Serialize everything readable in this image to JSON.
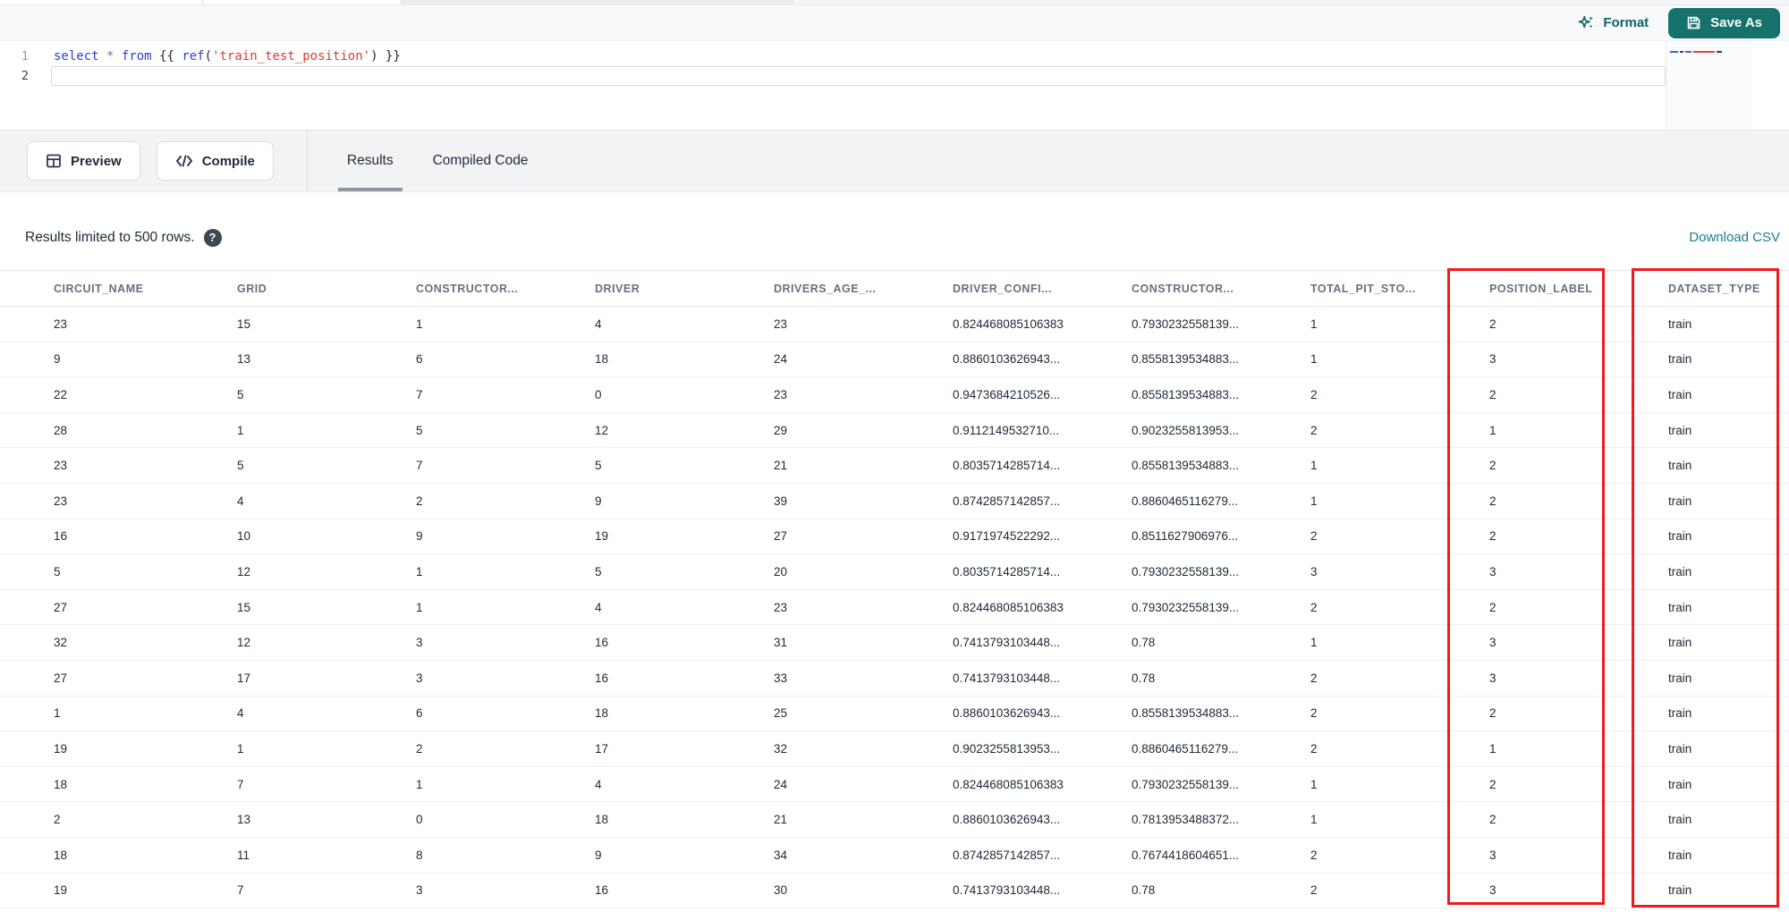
{
  "header": {
    "format_label": "Format",
    "save_as_label": "Save As"
  },
  "editor": {
    "lines": [
      {
        "number": "1",
        "tokens": [
          [
            "select",
            "kw"
          ],
          [
            " ",
            "pl"
          ],
          [
            "*",
            "op"
          ],
          [
            " ",
            "pl"
          ],
          [
            "from",
            "kw"
          ],
          [
            " {{ ",
            "pl"
          ],
          [
            "ref",
            "fn"
          ],
          [
            "(",
            "pl"
          ],
          [
            "'train_test_position'",
            "str"
          ],
          [
            ") }}",
            "pl"
          ]
        ]
      },
      {
        "number": "2",
        "tokens": []
      }
    ]
  },
  "actionbar": {
    "preview_label": "Preview",
    "compile_label": "Compile",
    "tabs": [
      {
        "label": "Results",
        "active": true
      },
      {
        "label": "Compiled Code",
        "active": false
      }
    ]
  },
  "meta": {
    "limit_notice": "Results limited to 500 rows.",
    "help_glyph": "?",
    "download_label": "Download CSV"
  },
  "results": {
    "columns": [
      "CIRCUIT_NAME",
      "GRID",
      "CONSTRUCTOR...",
      "DRIVER",
      "DRIVERS_AGE_...",
      "DRIVER_CONFI...",
      "CONSTRUCTOR...",
      "TOTAL_PIT_STO...",
      "POSITION_LABEL",
      "DATASET_TYPE"
    ],
    "rows": [
      [
        "23",
        "15",
        "1",
        "4",
        "23",
        "0.824468085106383",
        "0.7930232558139...",
        "1",
        "2",
        "train"
      ],
      [
        "9",
        "13",
        "6",
        "18",
        "24",
        "0.8860103626943...",
        "0.8558139534883...",
        "1",
        "3",
        "train"
      ],
      [
        "22",
        "5",
        "7",
        "0",
        "23",
        "0.9473684210526...",
        "0.8558139534883...",
        "2",
        "2",
        "train"
      ],
      [
        "28",
        "1",
        "5",
        "12",
        "29",
        "0.9112149532710...",
        "0.9023255813953...",
        "2",
        "1",
        "train"
      ],
      [
        "23",
        "5",
        "7",
        "5",
        "21",
        "0.8035714285714...",
        "0.8558139534883...",
        "1",
        "2",
        "train"
      ],
      [
        "23",
        "4",
        "2",
        "9",
        "39",
        "0.8742857142857...",
        "0.8860465116279...",
        "1",
        "2",
        "train"
      ],
      [
        "16",
        "10",
        "9",
        "19",
        "27",
        "0.9171974522292...",
        "0.8511627906976...",
        "2",
        "2",
        "train"
      ],
      [
        "5",
        "12",
        "1",
        "5",
        "20",
        "0.8035714285714...",
        "0.7930232558139...",
        "3",
        "3",
        "train"
      ],
      [
        "27",
        "15",
        "1",
        "4",
        "23",
        "0.824468085106383",
        "0.7930232558139...",
        "2",
        "2",
        "train"
      ],
      [
        "32",
        "12",
        "3",
        "16",
        "31",
        "0.7413793103448...",
        "0.78",
        "1",
        "3",
        "train"
      ],
      [
        "27",
        "17",
        "3",
        "16",
        "33",
        "0.7413793103448...",
        "0.78",
        "2",
        "3",
        "train"
      ],
      [
        "1",
        "4",
        "6",
        "18",
        "25",
        "0.8860103626943...",
        "0.8558139534883...",
        "2",
        "2",
        "train"
      ],
      [
        "19",
        "1",
        "2",
        "17",
        "32",
        "0.9023255813953...",
        "0.8860465116279...",
        "2",
        "1",
        "train"
      ],
      [
        "18",
        "7",
        "1",
        "4",
        "24",
        "0.824468085106383",
        "0.7930232558139...",
        "1",
        "2",
        "train"
      ],
      [
        "2",
        "13",
        "0",
        "18",
        "21",
        "0.8860103626943...",
        "0.7813953488372...",
        "1",
        "2",
        "train"
      ],
      [
        "18",
        "11",
        "8",
        "9",
        "34",
        "0.8742857142857...",
        "0.7674418604651...",
        "2",
        "3",
        "train"
      ],
      [
        "19",
        "7",
        "3",
        "16",
        "30",
        "0.7413793103448...",
        "0.78",
        "2",
        "3",
        "train"
      ]
    ],
    "annotation": {
      "highlighted_columns": [
        "POSITION_LABEL",
        "DATASET_TYPE"
      ],
      "color": "#ee1b20"
    }
  },
  "colors": {
    "teal_button": "#14716c",
    "teal_format_text": "#135f66",
    "download_link_teal": "#1b7e92",
    "keyword_blue": "#2a3fd4",
    "string_red": "#d93b36",
    "annotation_red": "#ee1b20"
  }
}
